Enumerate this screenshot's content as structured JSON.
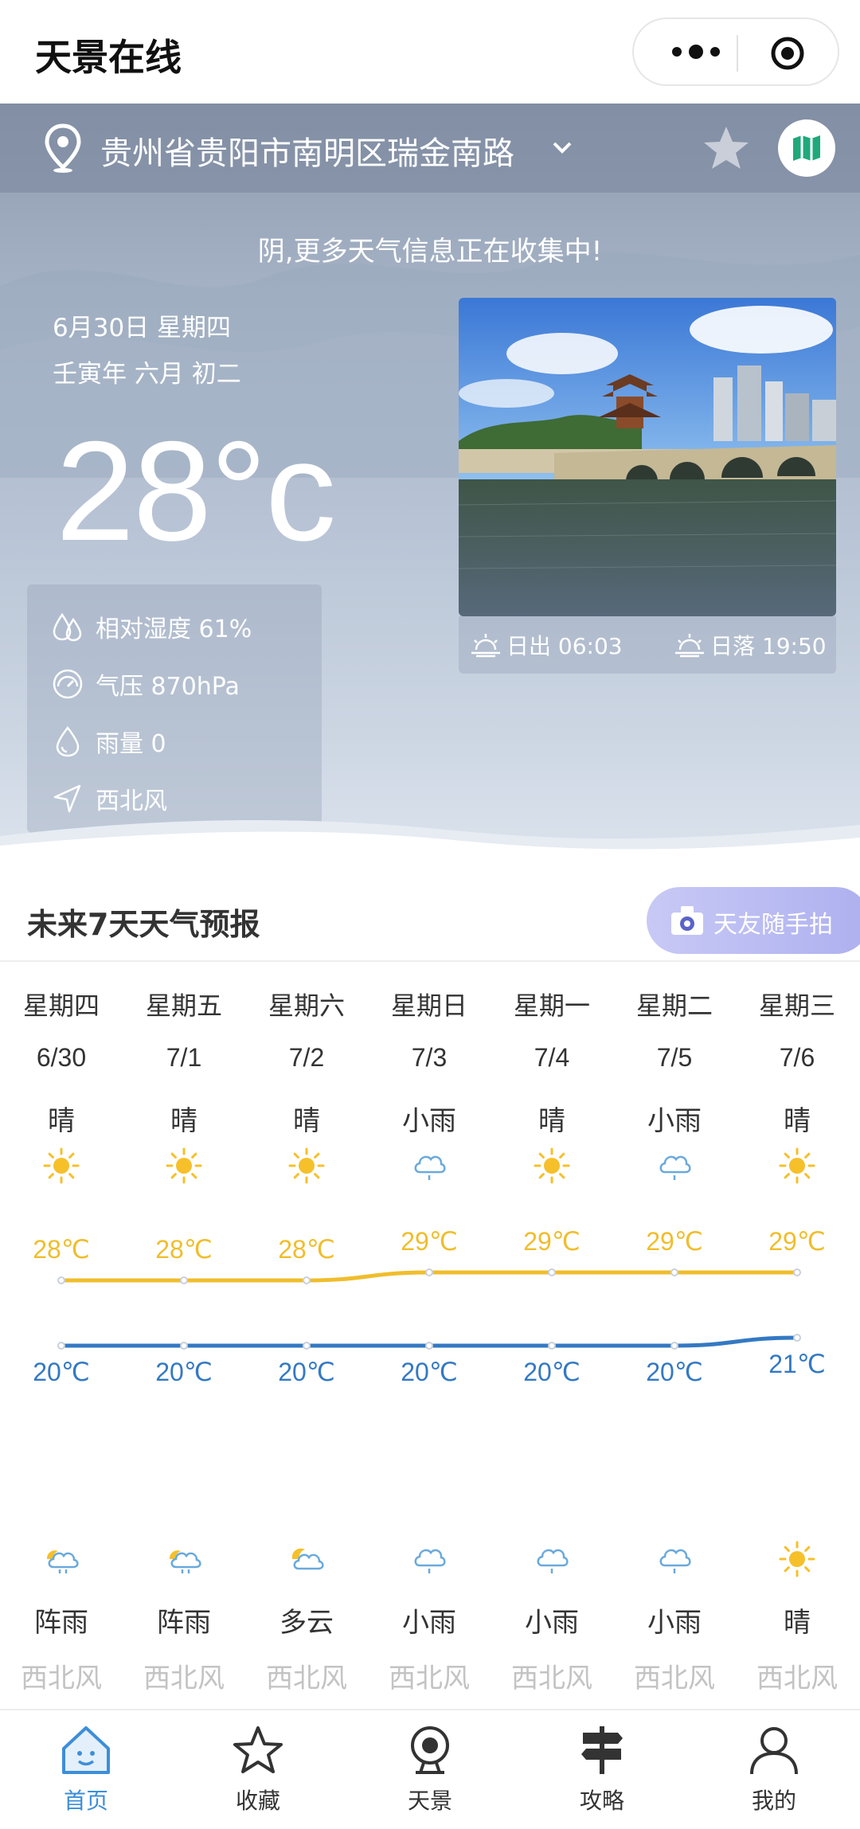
{
  "app_title": "天景在线",
  "location": {
    "address": "贵州省贵阳市南明区瑞金南路"
  },
  "notice": "阴,更多天气信息正在收集中!",
  "today": {
    "date": "6月30日 星期四",
    "lunar": "壬寅年 六月 初二",
    "temperature": "28°c",
    "humidity": "相对湿度 61%",
    "pressure": "气压 870hPa",
    "rain": "雨量 0",
    "wind": "西北风",
    "sunrise": "日出 06:03",
    "sunset": "日落 19:50"
  },
  "forecast": {
    "title": "未来7天天气预报",
    "friend_button": "天友随手拍",
    "days": [
      {
        "dow": "星期四",
        "date": "6/30",
        "day_cond": "晴",
        "day_icon": "sun",
        "high": "28℃",
        "high_value": 28,
        "low": "20℃",
        "low_value": 20,
        "night_icon": "partly-cloudy-rain",
        "night_cond": "阵雨",
        "wind": "西北风"
      },
      {
        "dow": "星期五",
        "date": "7/1",
        "day_cond": "晴",
        "day_icon": "sun",
        "high": "28℃",
        "high_value": 28,
        "low": "20℃",
        "low_value": 20,
        "night_icon": "partly-cloudy-rain",
        "night_cond": "阵雨",
        "wind": "西北风"
      },
      {
        "dow": "星期六",
        "date": "7/2",
        "day_cond": "晴",
        "day_icon": "sun",
        "high": "28℃",
        "high_value": 28,
        "low": "20℃",
        "low_value": 20,
        "night_icon": "partly-cloudy",
        "night_cond": "多云",
        "wind": "西北风"
      },
      {
        "dow": "星期日",
        "date": "7/3",
        "day_cond": "小雨",
        "day_icon": "rain",
        "high": "29℃",
        "high_value": 29,
        "low": "20℃",
        "low_value": 20,
        "night_icon": "rain",
        "night_cond": "小雨",
        "wind": "西北风"
      },
      {
        "dow": "星期一",
        "date": "7/4",
        "day_cond": "晴",
        "day_icon": "sun",
        "high": "29℃",
        "high_value": 29,
        "low": "20℃",
        "low_value": 20,
        "night_icon": "rain",
        "night_cond": "小雨",
        "wind": "西北风"
      },
      {
        "dow": "星期二",
        "date": "7/5",
        "day_cond": "小雨",
        "day_icon": "rain",
        "high": "29℃",
        "high_value": 29,
        "low": "20℃",
        "low_value": 20,
        "night_icon": "rain",
        "night_cond": "小雨",
        "wind": "西北风"
      },
      {
        "dow": "星期三",
        "date": "7/6",
        "day_cond": "晴",
        "day_icon": "sun",
        "high": "29℃",
        "high_value": 29,
        "low": "21℃",
        "low_value": 21,
        "night_icon": "sun",
        "night_cond": "晴",
        "wind": "西北风"
      }
    ]
  },
  "tabs": [
    {
      "label": "首页",
      "icon": "home-icon",
      "active": true
    },
    {
      "label": "收藏",
      "icon": "star-icon",
      "active": false
    },
    {
      "label": "天景",
      "icon": "camera-icon",
      "active": false
    },
    {
      "label": "攻略",
      "icon": "signpost-icon",
      "active": false
    },
    {
      "label": "我的",
      "icon": "user-icon",
      "active": false
    }
  ],
  "colors": {
    "high_line": "#f0bd2c",
    "low_line": "#3479c3",
    "active_tab": "#3d8ed8",
    "sun": "#f5c02a",
    "rain_icon": "#6aa9dd"
  }
}
